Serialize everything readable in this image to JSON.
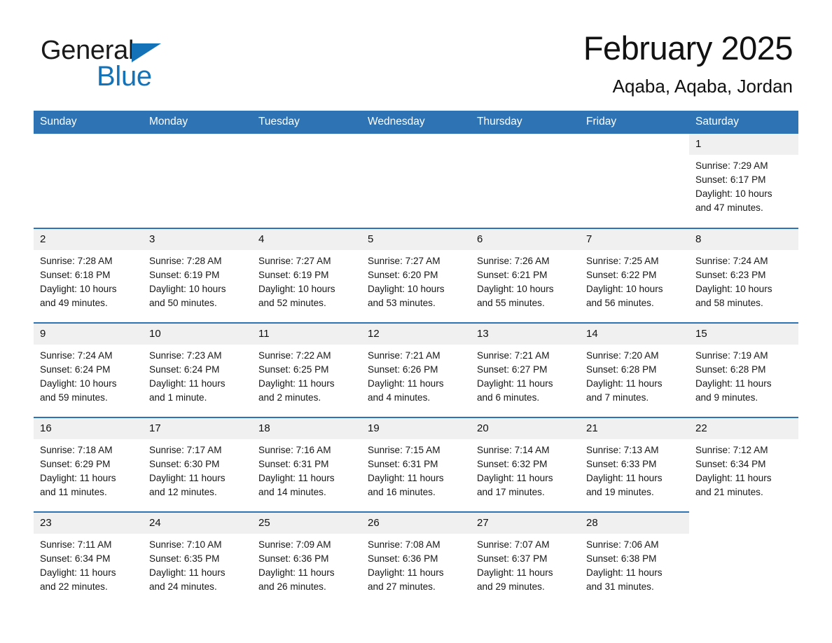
{
  "brand": {
    "name_part1": "General",
    "name_part2": "Blue",
    "logo_icon": "triangle-flag-icon",
    "accent_color": "#1473b8"
  },
  "header": {
    "title": "February 2025",
    "subtitle": "Aqaba, Aqaba, Jordan"
  },
  "theme": {
    "header_blue": "#2e74b5",
    "daynum_gray": "#f0f0f0",
    "text": "#111111"
  },
  "weekday_headers": [
    "Sunday",
    "Monday",
    "Tuesday",
    "Wednesday",
    "Thursday",
    "Friday",
    "Saturday"
  ],
  "weeks": [
    [
      {
        "day": "",
        "empty": true,
        "sunrise": "",
        "sunset": "",
        "daylight1": "",
        "daylight2": ""
      },
      {
        "day": "",
        "empty": true,
        "sunrise": "",
        "sunset": "",
        "daylight1": "",
        "daylight2": ""
      },
      {
        "day": "",
        "empty": true,
        "sunrise": "",
        "sunset": "",
        "daylight1": "",
        "daylight2": ""
      },
      {
        "day": "",
        "empty": true,
        "sunrise": "",
        "sunset": "",
        "daylight1": "",
        "daylight2": ""
      },
      {
        "day": "",
        "empty": true,
        "sunrise": "",
        "sunset": "",
        "daylight1": "",
        "daylight2": ""
      },
      {
        "day": "",
        "empty": true,
        "sunrise": "",
        "sunset": "",
        "daylight1": "",
        "daylight2": ""
      },
      {
        "day": "1",
        "empty": false,
        "sunrise": "Sunrise: 7:29 AM",
        "sunset": "Sunset: 6:17 PM",
        "daylight1": "Daylight: 10 hours",
        "daylight2": "and 47 minutes."
      }
    ],
    [
      {
        "day": "2",
        "empty": false,
        "sunrise": "Sunrise: 7:28 AM",
        "sunset": "Sunset: 6:18 PM",
        "daylight1": "Daylight: 10 hours",
        "daylight2": "and 49 minutes."
      },
      {
        "day": "3",
        "empty": false,
        "sunrise": "Sunrise: 7:28 AM",
        "sunset": "Sunset: 6:19 PM",
        "daylight1": "Daylight: 10 hours",
        "daylight2": "and 50 minutes."
      },
      {
        "day": "4",
        "empty": false,
        "sunrise": "Sunrise: 7:27 AM",
        "sunset": "Sunset: 6:19 PM",
        "daylight1": "Daylight: 10 hours",
        "daylight2": "and 52 minutes."
      },
      {
        "day": "5",
        "empty": false,
        "sunrise": "Sunrise: 7:27 AM",
        "sunset": "Sunset: 6:20 PM",
        "daylight1": "Daylight: 10 hours",
        "daylight2": "and 53 minutes."
      },
      {
        "day": "6",
        "empty": false,
        "sunrise": "Sunrise: 7:26 AM",
        "sunset": "Sunset: 6:21 PM",
        "daylight1": "Daylight: 10 hours",
        "daylight2": "and 55 minutes."
      },
      {
        "day": "7",
        "empty": false,
        "sunrise": "Sunrise: 7:25 AM",
        "sunset": "Sunset: 6:22 PM",
        "daylight1": "Daylight: 10 hours",
        "daylight2": "and 56 minutes."
      },
      {
        "day": "8",
        "empty": false,
        "sunrise": "Sunrise: 7:24 AM",
        "sunset": "Sunset: 6:23 PM",
        "daylight1": "Daylight: 10 hours",
        "daylight2": "and 58 minutes."
      }
    ],
    [
      {
        "day": "9",
        "empty": false,
        "sunrise": "Sunrise: 7:24 AM",
        "sunset": "Sunset: 6:24 PM",
        "daylight1": "Daylight: 10 hours",
        "daylight2": "and 59 minutes."
      },
      {
        "day": "10",
        "empty": false,
        "sunrise": "Sunrise: 7:23 AM",
        "sunset": "Sunset: 6:24 PM",
        "daylight1": "Daylight: 11 hours",
        "daylight2": "and 1 minute."
      },
      {
        "day": "11",
        "empty": false,
        "sunrise": "Sunrise: 7:22 AM",
        "sunset": "Sunset: 6:25 PM",
        "daylight1": "Daylight: 11 hours",
        "daylight2": "and 2 minutes."
      },
      {
        "day": "12",
        "empty": false,
        "sunrise": "Sunrise: 7:21 AM",
        "sunset": "Sunset: 6:26 PM",
        "daylight1": "Daylight: 11 hours",
        "daylight2": "and 4 minutes."
      },
      {
        "day": "13",
        "empty": false,
        "sunrise": "Sunrise: 7:21 AM",
        "sunset": "Sunset: 6:27 PM",
        "daylight1": "Daylight: 11 hours",
        "daylight2": "and 6 minutes."
      },
      {
        "day": "14",
        "empty": false,
        "sunrise": "Sunrise: 7:20 AM",
        "sunset": "Sunset: 6:28 PM",
        "daylight1": "Daylight: 11 hours",
        "daylight2": "and 7 minutes."
      },
      {
        "day": "15",
        "empty": false,
        "sunrise": "Sunrise: 7:19 AM",
        "sunset": "Sunset: 6:28 PM",
        "daylight1": "Daylight: 11 hours",
        "daylight2": "and 9 minutes."
      }
    ],
    [
      {
        "day": "16",
        "empty": false,
        "sunrise": "Sunrise: 7:18 AM",
        "sunset": "Sunset: 6:29 PM",
        "daylight1": "Daylight: 11 hours",
        "daylight2": "and 11 minutes."
      },
      {
        "day": "17",
        "empty": false,
        "sunrise": "Sunrise: 7:17 AM",
        "sunset": "Sunset: 6:30 PM",
        "daylight1": "Daylight: 11 hours",
        "daylight2": "and 12 minutes."
      },
      {
        "day": "18",
        "empty": false,
        "sunrise": "Sunrise: 7:16 AM",
        "sunset": "Sunset: 6:31 PM",
        "daylight1": "Daylight: 11 hours",
        "daylight2": "and 14 minutes."
      },
      {
        "day": "19",
        "empty": false,
        "sunrise": "Sunrise: 7:15 AM",
        "sunset": "Sunset: 6:31 PM",
        "daylight1": "Daylight: 11 hours",
        "daylight2": "and 16 minutes."
      },
      {
        "day": "20",
        "empty": false,
        "sunrise": "Sunrise: 7:14 AM",
        "sunset": "Sunset: 6:32 PM",
        "daylight1": "Daylight: 11 hours",
        "daylight2": "and 17 minutes."
      },
      {
        "day": "21",
        "empty": false,
        "sunrise": "Sunrise: 7:13 AM",
        "sunset": "Sunset: 6:33 PM",
        "daylight1": "Daylight: 11 hours",
        "daylight2": "and 19 minutes."
      },
      {
        "day": "22",
        "empty": false,
        "sunrise": "Sunrise: 7:12 AM",
        "sunset": "Sunset: 6:34 PM",
        "daylight1": "Daylight: 11 hours",
        "daylight2": "and 21 minutes."
      }
    ],
    [
      {
        "day": "23",
        "empty": false,
        "sunrise": "Sunrise: 7:11 AM",
        "sunset": "Sunset: 6:34 PM",
        "daylight1": "Daylight: 11 hours",
        "daylight2": "and 22 minutes."
      },
      {
        "day": "24",
        "empty": false,
        "sunrise": "Sunrise: 7:10 AM",
        "sunset": "Sunset: 6:35 PM",
        "daylight1": "Daylight: 11 hours",
        "daylight2": "and 24 minutes."
      },
      {
        "day": "25",
        "empty": false,
        "sunrise": "Sunrise: 7:09 AM",
        "sunset": "Sunset: 6:36 PM",
        "daylight1": "Daylight: 11 hours",
        "daylight2": "and 26 minutes."
      },
      {
        "day": "26",
        "empty": false,
        "sunrise": "Sunrise: 7:08 AM",
        "sunset": "Sunset: 6:36 PM",
        "daylight1": "Daylight: 11 hours",
        "daylight2": "and 27 minutes."
      },
      {
        "day": "27",
        "empty": false,
        "sunrise": "Sunrise: 7:07 AM",
        "sunset": "Sunset: 6:37 PM",
        "daylight1": "Daylight: 11 hours",
        "daylight2": "and 29 minutes."
      },
      {
        "day": "28",
        "empty": false,
        "sunrise": "Sunrise: 7:06 AM",
        "sunset": "Sunset: 6:38 PM",
        "daylight1": "Daylight: 11 hours",
        "daylight2": "and 31 minutes."
      },
      {
        "day": "",
        "empty": true,
        "sunrise": "",
        "sunset": "",
        "daylight1": "",
        "daylight2": ""
      }
    ]
  ]
}
